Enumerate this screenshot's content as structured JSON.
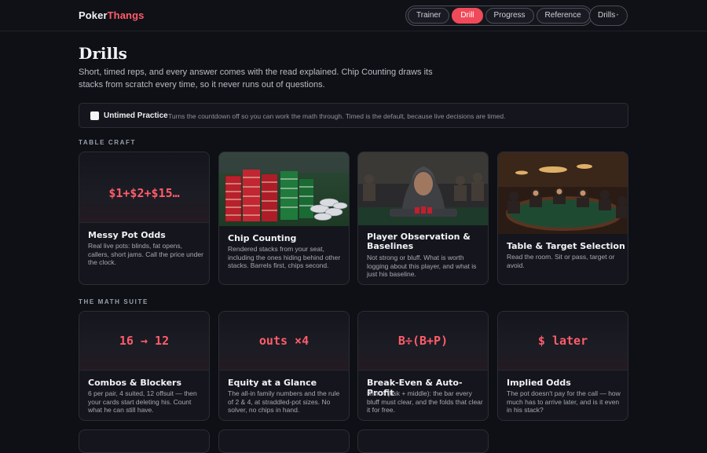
{
  "app": {
    "brand_part1": "Poker",
    "brand_part2": "Thangs"
  },
  "nav": {
    "items": [
      {
        "label": "Trainer",
        "active": false
      },
      {
        "label": "Drill",
        "active": true
      },
      {
        "label": "Progress",
        "active": false
      },
      {
        "label": "Reference",
        "active": false
      }
    ],
    "menu_label": "Drills",
    "menu_caret": "•"
  },
  "page": {
    "title": "Drills",
    "intro": "Short, timed reps, and every answer comes with the read explained. Chip Counting draws its stacks from scratch every time, so it never runs out of questions."
  },
  "untimed": {
    "checked": false,
    "label": "Untimed Practice",
    "description": "Turns the countdown off so you can work the math through. Timed is the default, because live decisions are timed."
  },
  "sections": {
    "table_craft": "TABLE CRAFT",
    "math_suite": "THE MATH SUITE"
  },
  "table_craft": [
    {
      "glyph": "$1+$2+$15…",
      "title": "Messy Pot Odds",
      "description": "Real live pots: blinds, fat opens, callers, short jams. Call the price under the clock."
    },
    {
      "title": "Chip Counting",
      "description": "Rendered stacks from your seat, including the ones hiding behind other stacks. Barrels first, chips second."
    },
    {
      "title": "Player Observation & Baselines",
      "description": "Not strong or bluff. What is worth logging about this player, and what is just his baseline."
    },
    {
      "title": "Table & Target Selection",
      "description": "Read the room. Sit or pass, target or avoid."
    }
  ],
  "math_suite": [
    {
      "glyph": "16 → 12",
      "title": "Combos & Blockers",
      "description": "6 per pair, 4 suited, 12 offsuit — then your cards start deleting his. Count what he can still have."
    },
    {
      "glyph": "outs ×4",
      "title": "Equity at a Glance",
      "description": "The all-in family numbers and the rule of 2 & 4, at straddled-pot sizes. No solver, no chips in hand."
    },
    {
      "glyph": "B÷(B+P)",
      "title": "Break-Even & Auto-Profit",
      "description": "Risk ÷ (risk + middle): the bar every bluff must clear, and the folds that clear it for free."
    },
    {
      "glyph": "$ later",
      "title": "Implied Odds",
      "description": "The pot doesn't pay for the call — how much has to arrive later, and is it even in his stack?"
    }
  ],
  "colors": {
    "accent": "#ff5c6a",
    "active_nav": "#f04a5a",
    "background": "#0f1015",
    "card": "#15161d"
  }
}
